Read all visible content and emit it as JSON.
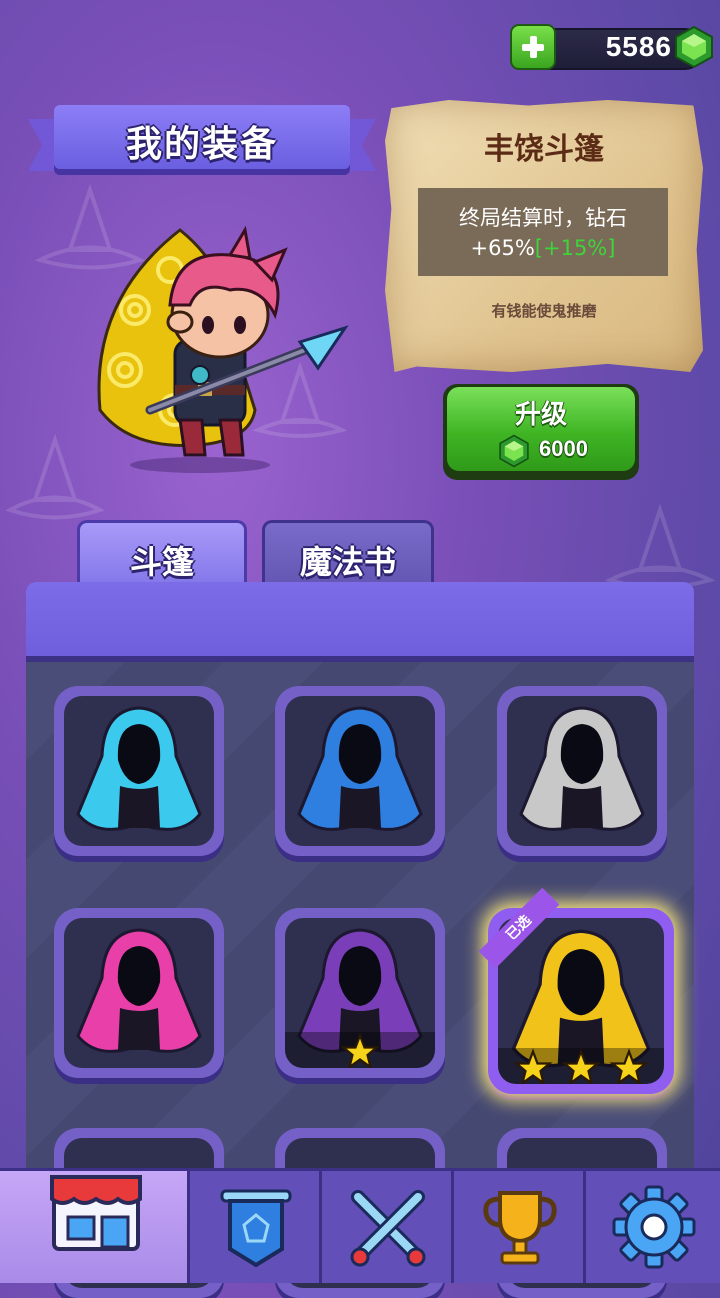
{
  "currency": {
    "amount": "5586",
    "plus_icon": "plus-icon",
    "gem_icon": "gem-icon"
  },
  "title": "我的装备",
  "item": {
    "name": "丰饶斗篷",
    "desc_line1": "终局结算时，钻石",
    "desc_base": "+65%",
    "desc_bonus": "[+15%]",
    "subtitle": "有钱能使鬼推磨"
  },
  "upgrade": {
    "label": "升级",
    "cost": "6000"
  },
  "tabs": [
    {
      "label": "斗篷",
      "active": true
    },
    {
      "label": "魔法书",
      "active": false
    }
  ],
  "cloaks": [
    {
      "name": "cyan-cloak",
      "color": "#3cc9ee",
      "stars": 0,
      "selected": false
    },
    {
      "name": "blue-star-cloak",
      "color": "#2f7fe0",
      "stars": 0,
      "selected": false
    },
    {
      "name": "plaid-cloak",
      "color": "#c8c8c8",
      "stars": 0,
      "selected": false
    },
    {
      "name": "pink-heart-cloak",
      "color": "#e83fa8",
      "stars": 0,
      "selected": false
    },
    {
      "name": "purple-star-cloak",
      "color": "#7a3fb8",
      "stars": 1,
      "selected": false
    },
    {
      "name": "gold-cloak",
      "color": "#f1c21a",
      "stars": 3,
      "selected": true
    }
  ],
  "selected_tag": "已选",
  "nav": [
    {
      "name": "shop-icon",
      "active": true
    },
    {
      "name": "banner-icon",
      "active": false
    },
    {
      "name": "battle-icon",
      "active": false
    },
    {
      "name": "trophy-icon",
      "active": false
    },
    {
      "name": "settings-icon",
      "active": false
    }
  ],
  "colors": {
    "accent_green": "#3fb524",
    "bonus_green": "#3fd43a",
    "gold": "#f1c21a"
  }
}
